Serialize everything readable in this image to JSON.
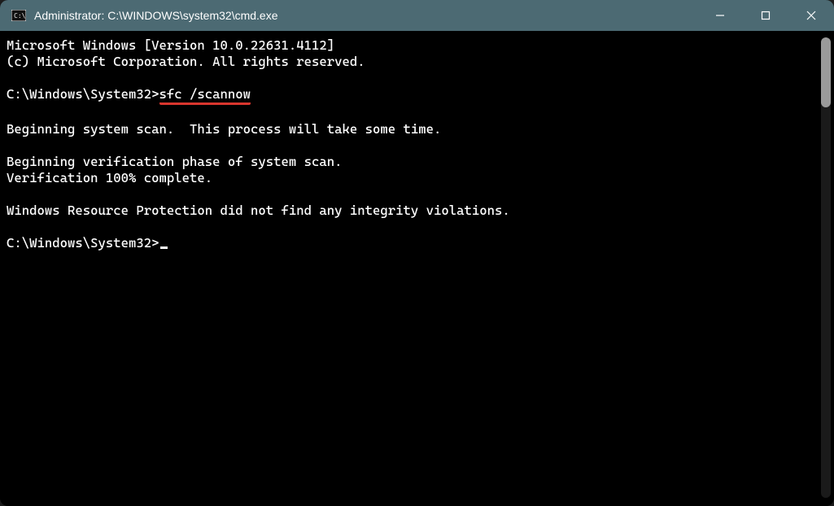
{
  "window": {
    "title": "Administrator: C:\\WINDOWS\\system32\\cmd.exe"
  },
  "terminal": {
    "line1": "Microsoft Windows [Version 10.0.22631.4112]",
    "line2": "(c) Microsoft Corporation. All rights reserved.",
    "blank1": "",
    "prompt1": "C:\\Windows\\System32>",
    "command1": "sfc /scannow",
    "blank2": "",
    "line3": "Beginning system scan.  This process will take some time.",
    "blank3": "",
    "line4": "Beginning verification phase of system scan.",
    "line5": "Verification 100% complete.",
    "blank4": "",
    "line6": "Windows Resource Protection did not find any integrity violations.",
    "blank5": "",
    "prompt2": "C:\\Windows\\System32>"
  }
}
